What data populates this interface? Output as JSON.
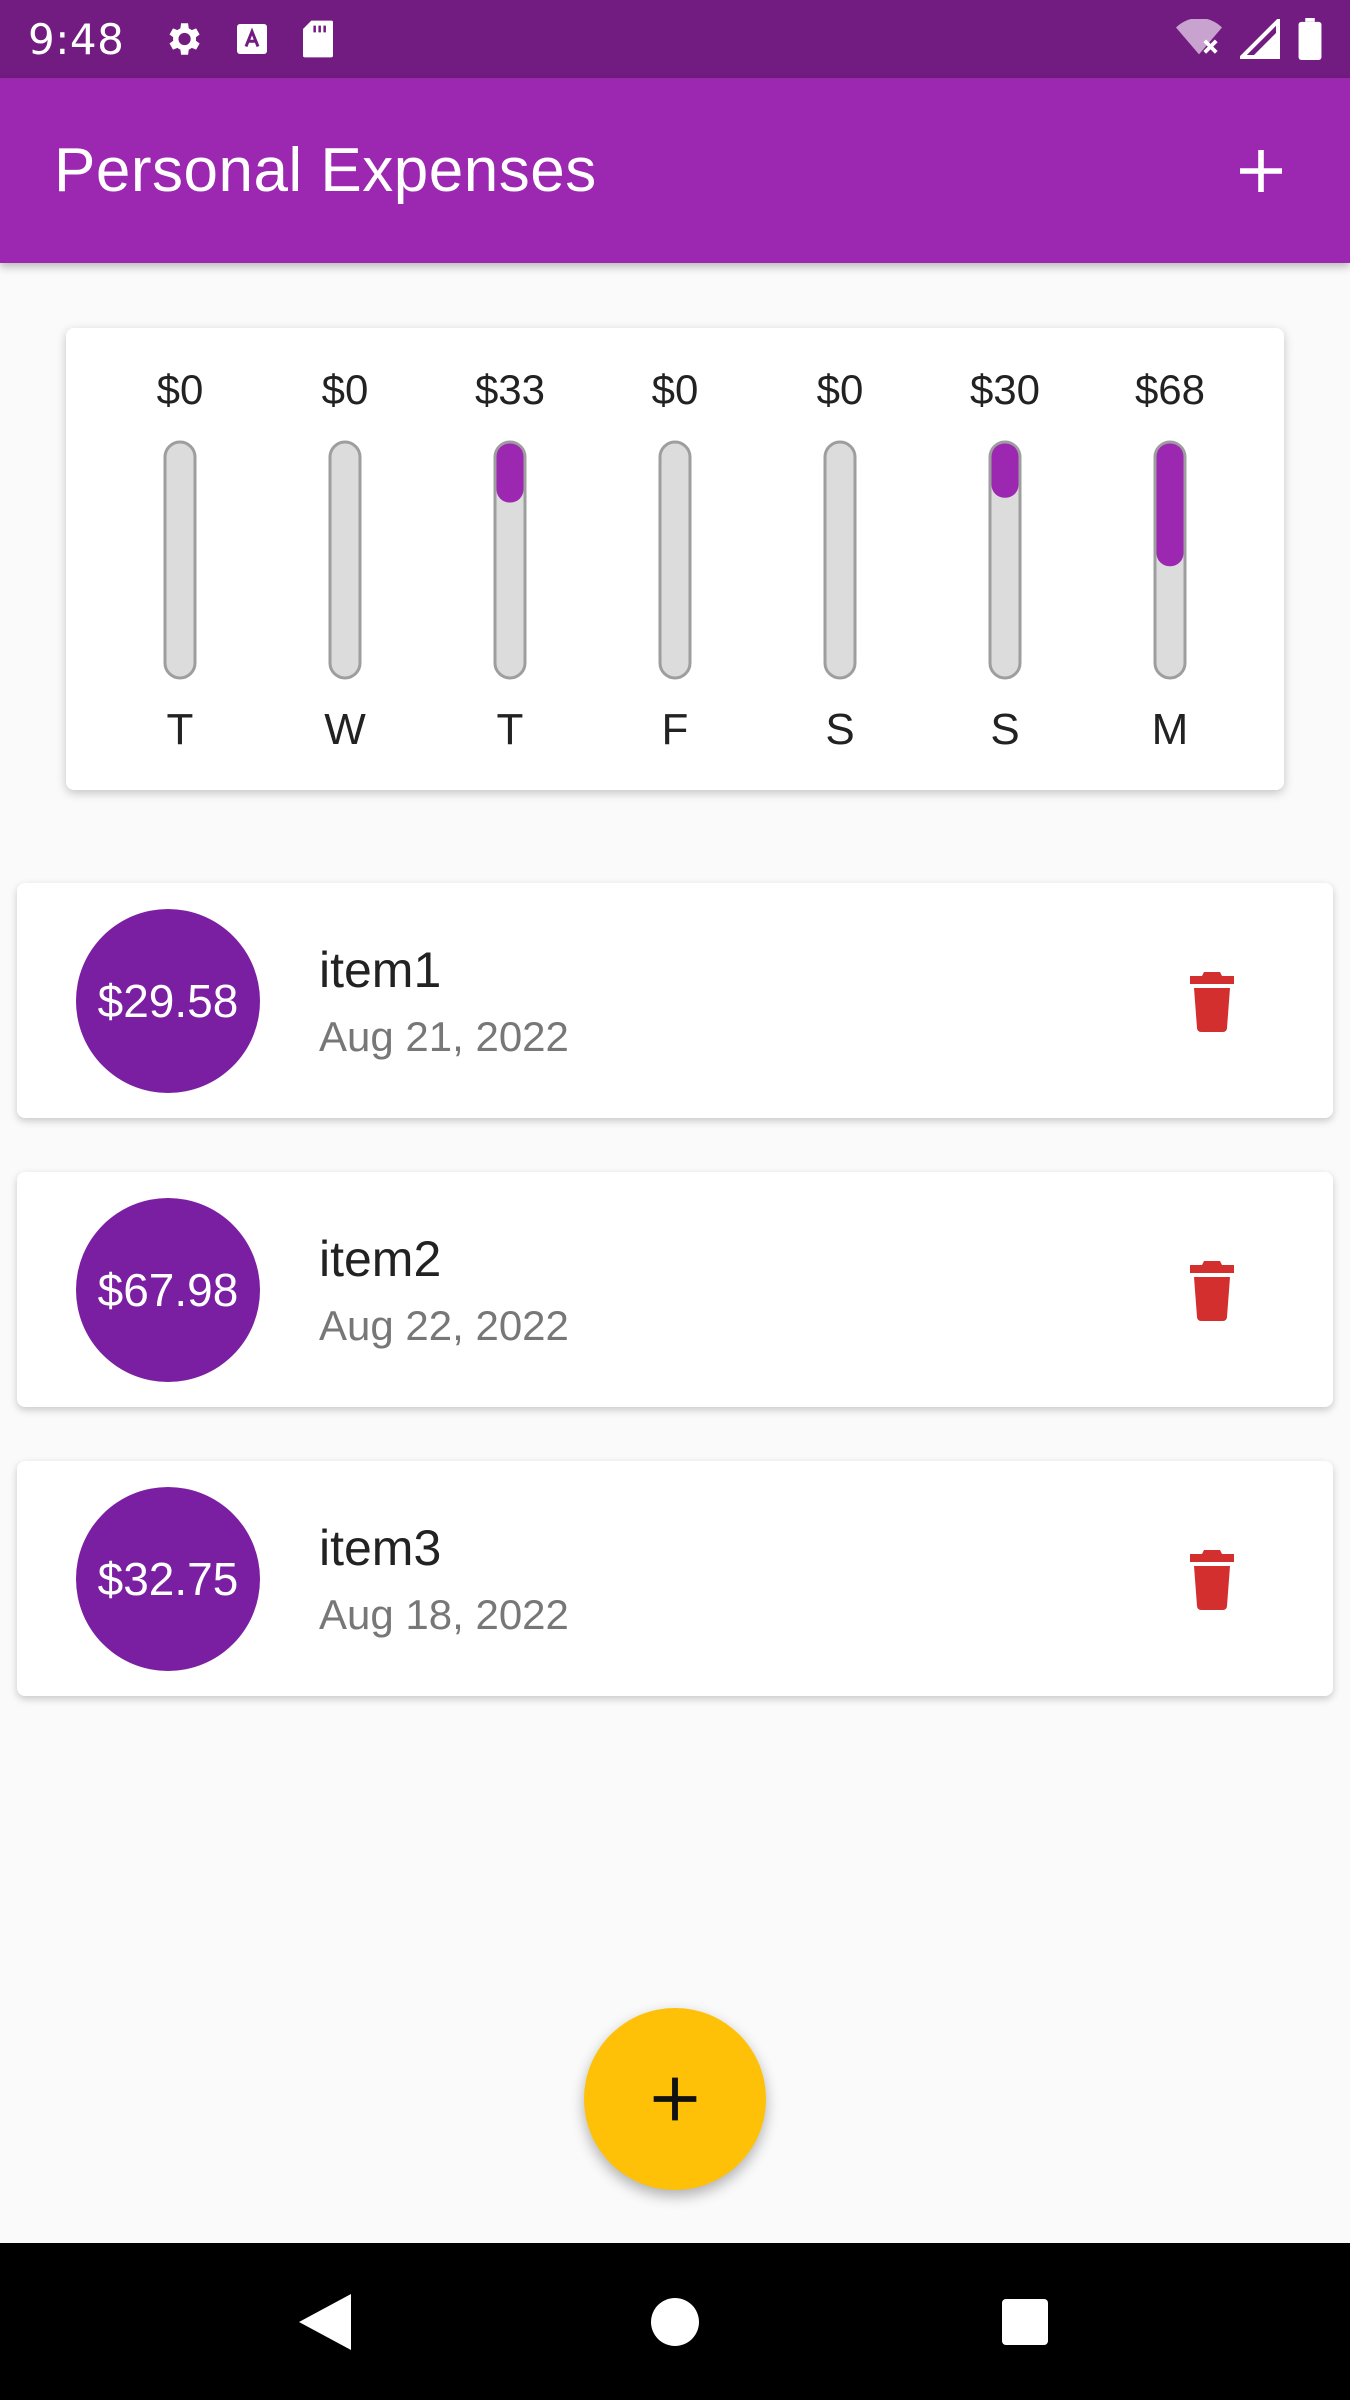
{
  "status_bar": {
    "time": "9:48",
    "icons_left": [
      "settings-icon",
      "text-a-icon",
      "sd-card-icon"
    ],
    "icons_right": [
      "wifi-off-icon",
      "signal-icon",
      "battery-icon"
    ]
  },
  "app_bar": {
    "title": "Personal Expenses",
    "add_icon": "plus-icon"
  },
  "chart_data": {
    "type": "bar",
    "categories": [
      "T",
      "W",
      "T",
      "F",
      "S",
      "S",
      "M"
    ],
    "labels": [
      "$0",
      "$0",
      "$33",
      "$0",
      "$0",
      "$30",
      "$68"
    ],
    "values": [
      0,
      0,
      33,
      0,
      0,
      30,
      68
    ],
    "fill_fraction": [
      0,
      0,
      0.25,
      0,
      0,
      0.23,
      0.52
    ],
    "colors": {
      "fill": "#9c27b0",
      "track": "#dcdcdc",
      "track_border": "#9e9e9e"
    }
  },
  "transactions": [
    {
      "amount": "$29.58",
      "title": "item1",
      "date": "Aug 21, 2022"
    },
    {
      "amount": "$67.98",
      "title": "item2",
      "date": "Aug 22, 2022"
    },
    {
      "amount": "$32.75",
      "title": "item3",
      "date": "Aug 18, 2022"
    }
  ],
  "colors": {
    "status_bar": "#721b80",
    "primary": "#9c27b0",
    "avatar": "#7b1fa2",
    "accent": "#ffc107",
    "delete": "#d32f2f"
  },
  "fab": {
    "icon": "plus-icon"
  },
  "nav_bar": {
    "icons": [
      "back-icon",
      "home-icon",
      "recents-icon"
    ]
  }
}
